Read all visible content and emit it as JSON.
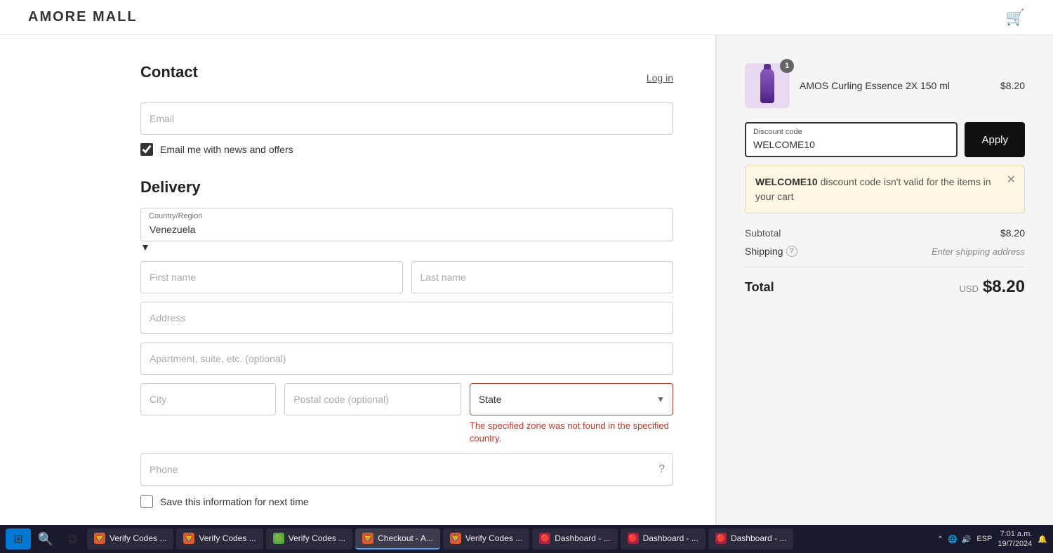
{
  "header": {
    "logo": "AMORE MALL",
    "cart_icon": "🛒"
  },
  "contact": {
    "title": "Contact",
    "login_text": "Log in",
    "email_placeholder": "Email",
    "checkbox_checked": true,
    "checkbox_label": "Email me with news and offers"
  },
  "delivery": {
    "title": "Delivery",
    "country_label": "Country/Region",
    "country_value": "Venezuela",
    "first_name_placeholder": "First name",
    "last_name_placeholder": "Last name",
    "address_placeholder": "Address",
    "apartment_placeholder": "Apartment, suite, etc. (optional)",
    "city_placeholder": "City",
    "postal_placeholder": "Postal code (optional)",
    "state_placeholder": "State",
    "state_error": "The specified zone was not found in the specified country.",
    "phone_placeholder": "Phone",
    "save_info_label": "Save this information for next time"
  },
  "order_summary": {
    "product_name": "AMOS Curling Essence 2X 150 ml",
    "product_price": "$8.20",
    "product_quantity": 1,
    "discount_label": "Discount code",
    "discount_value": "WELCOME10",
    "apply_label": "Apply",
    "discount_error_code": "WELCOME10",
    "discount_error_text": " discount code isn't valid for the items in your cart",
    "subtotal_label": "Subtotal",
    "subtotal_value": "$8.20",
    "shipping_label": "Shipping",
    "shipping_value": "Enter shipping address",
    "total_label": "Total",
    "total_currency": "USD",
    "total_amount": "$8.20"
  },
  "taskbar": {
    "time": "7:01 a.m.",
    "date": "19/7/2024",
    "language": "ESP",
    "apps": [
      {
        "label": "Verify Codes ...",
        "color": "#e05a2b"
      },
      {
        "label": "Verify Codes ...",
        "color": "#e05a2b"
      },
      {
        "label": "Verify Codes ...",
        "color": "#55aa44"
      },
      {
        "label": "Checkout - A...",
        "color": "#e05a2b",
        "active": true
      },
      {
        "label": "Verify Codes ...",
        "color": "#e05a2b"
      },
      {
        "label": "Dashboard - ...",
        "color": "#aa2244"
      },
      {
        "label": "Dashboard - ...",
        "color": "#aa2244"
      },
      {
        "label": "Dashboard - ...",
        "color": "#aa2244"
      }
    ]
  }
}
